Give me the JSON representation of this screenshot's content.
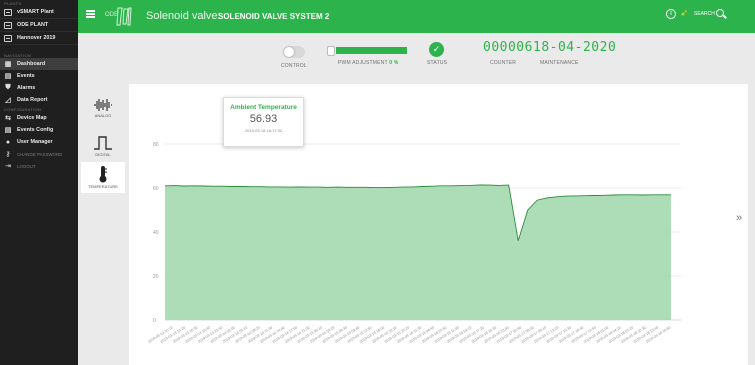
{
  "sidebar": {
    "plants_caption": "PLANTS",
    "plants": [
      {
        "label": "vSMART Plant"
      },
      {
        "label": "ODE PLANT"
      },
      {
        "label": "Hannover 2019"
      }
    ],
    "navigation_caption": "NAVIGATION",
    "nav": [
      {
        "label": "Dashboard",
        "icon": "dashboard-icon",
        "active": true
      },
      {
        "label": "Events",
        "icon": "calendar-icon"
      },
      {
        "label": "Alarms",
        "icon": "shield-icon"
      },
      {
        "label": "Data Report",
        "icon": "chart-icon"
      }
    ],
    "config_caption": "CONFIGURATION",
    "config": [
      {
        "label": "Device Map",
        "icon": "map-icon"
      },
      {
        "label": "Events Config",
        "icon": "calendar-icon"
      },
      {
        "label": "User Manager",
        "icon": "user-icon"
      }
    ],
    "account": [
      {
        "label": "CHANGE PASSWORD",
        "icon": "key-icon"
      },
      {
        "label": "LOGOUT",
        "icon": "logout-icon"
      }
    ]
  },
  "topbar": {
    "brand_text": "ODE",
    "valve_label": "Solenoid valve:",
    "valve_name": "SOLENOID VALVE SYSTEM 2",
    "search_label": "SEARCH",
    "accent_color": "#2db34b"
  },
  "status": {
    "control_label": "CONTROL",
    "pwm_label": "PWM ADJUSTMENT",
    "pwm_value": "0 %",
    "status_label": "STATUS",
    "counter_value": "000006",
    "counter_label": "COUNTER",
    "maintenance_value": "18-04-2020",
    "maintenance_label": "MAINTENANCE"
  },
  "types": [
    {
      "label": "ANALOG",
      "icon": "waveform-icon"
    },
    {
      "label": "DIGITAL",
      "icon": "square-wave-icon"
    },
    {
      "label": "TEMPERATURE",
      "icon": "thermometer-icon",
      "active": true
    }
  ],
  "tooltip": {
    "title": "Ambient Temperature",
    "value": "56.93",
    "date": "2019-03-18 18:17:32"
  },
  "chart_data": {
    "type": "area",
    "y_ticks": [
      0,
      20,
      40,
      60,
      80
    ],
    "ylim": [
      0,
      80
    ],
    "grid": true,
    "fill_color": "#a9dbb3",
    "line_color": "#2a8a3b",
    "x_tick_labels": [
      "2019-03-13 10:10",
      "2019-03-13 13:20",
      "2019-03-13 16:30",
      "2019-03-13 19:40",
      "2019-03-13 22:50",
      "2019-03-14 02:00",
      "2019-03-14 05:10",
      "2019-03-14 08:20",
      "2019-03-14 11:30",
      "2019-03-14 14:40",
      "2019-03-14 17:50",
      "2019-03-14 21:00",
      "2019-03-15 00:10",
      "2019-03-15 03:20",
      "2019-03-15 06:30",
      "2019-03-15 09:40",
      "2019-03-15 12:50",
      "2019-03-15 16:00",
      "2019-03-15 19:10",
      "2019-03-15 22:20",
      "2019-03-16 01:30",
      "2019-03-16 04:40",
      "2019-03-16 07:50",
      "2019-03-16 11:00",
      "2019-03-16 14:10",
      "2019-03-16 17:20",
      "2019-03-16 20:30",
      "2019-03-16 23:40",
      "2019-03-17 02:50",
      "2019-03-17 06:00",
      "2019-03-17 09:10",
      "2019-03-17 12:20",
      "2019-03-17 15:30",
      "2019-03-17 18:40",
      "2019-03-17 21:50",
      "2019-03-18 01:00",
      "2019-03-18 04:10",
      "2019-03-18 07:20",
      "2019-03-18 10:30",
      "2019-03-18 13:40",
      "2019-03-18 16:50"
    ],
    "series": [
      {
        "values": [
          61.0,
          61.1,
          60.9,
          61.0,
          60.9,
          60.8,
          60.8,
          60.7,
          60.7,
          60.6,
          60.6,
          60.5,
          60.5,
          60.4,
          60.5,
          60.4,
          60.4,
          60.3,
          60.4,
          60.3,
          60.3,
          60.3,
          60.2,
          60.2,
          60.3,
          60.4,
          60.5,
          60.7,
          60.8,
          61.0,
          61.0,
          61.1,
          61.2,
          61.4,
          61.3,
          61.2,
          61.3,
          36.0,
          50.0,
          54.5,
          55.5,
          56.0,
          56.3,
          56.4,
          56.5,
          56.6,
          56.7,
          56.8,
          56.9,
          56.9,
          56.8,
          56.9,
          56.9,
          56.93
        ]
      }
    ]
  }
}
